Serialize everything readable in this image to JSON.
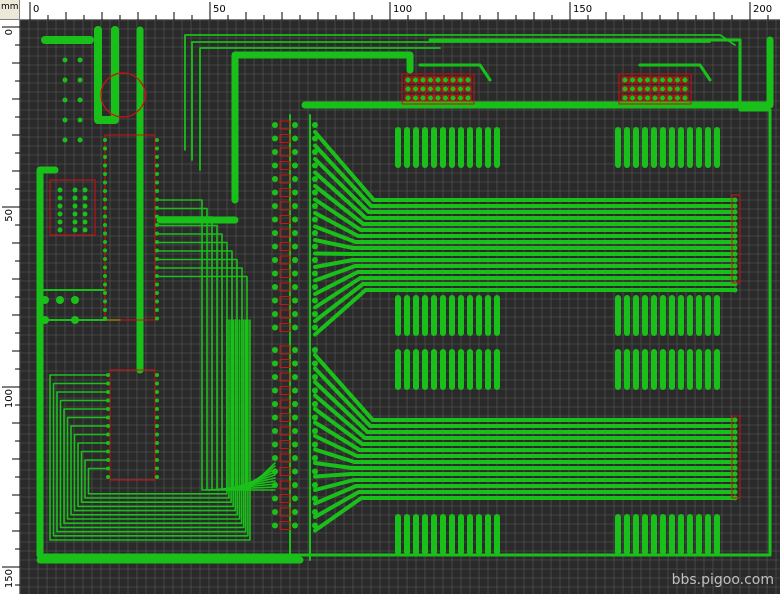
{
  "window": {
    "units_label": "mm"
  },
  "rulers": {
    "horizontal_labels": [
      "0",
      "50",
      "100",
      "150",
      "200"
    ],
    "vertical_labels": [
      "0",
      "50",
      "100",
      "150"
    ]
  },
  "watermark": {
    "text": "bbs.pigoo.com"
  },
  "colors": {
    "background": "#2a2a2a",
    "grid": "#5a5a5a",
    "copper": "#19c019",
    "pad_outline": "#d01010",
    "ruler_bg": "#ffffff"
  },
  "board": {
    "view": "pcb-layout",
    "layer": "top-copper"
  }
}
